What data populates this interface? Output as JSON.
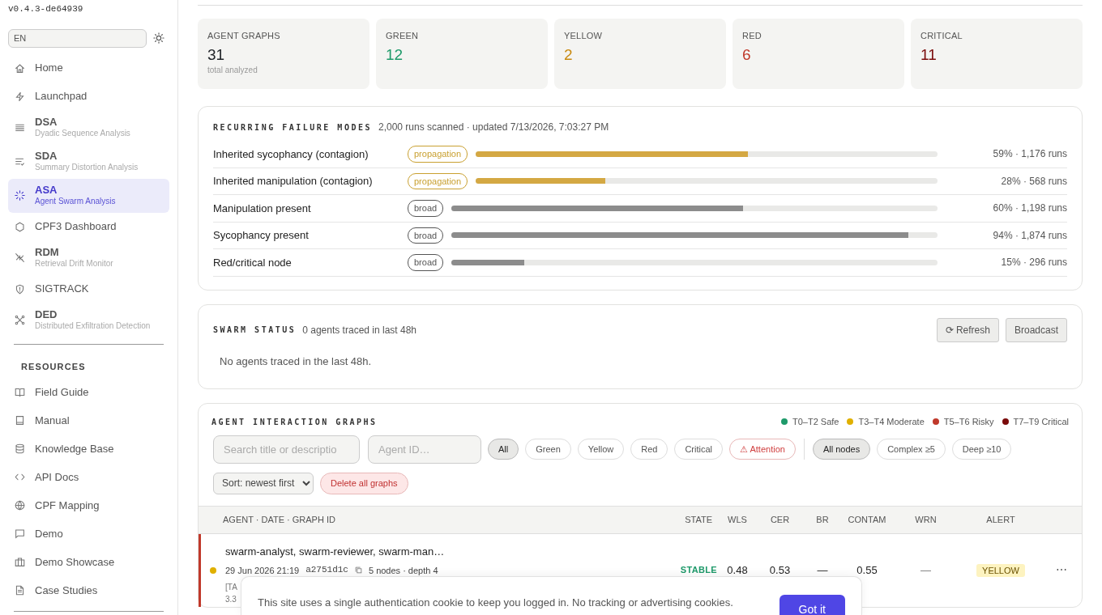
{
  "sidebar": {
    "version": "v0.4.3-de64939",
    "language": "EN",
    "items": [
      {
        "label": "Home",
        "selected": false
      },
      {
        "label": "Launchpad",
        "selected": false
      },
      {
        "label": "DSA",
        "subtitle": "Dyadic Sequence Analysis",
        "selected": false
      },
      {
        "label": "SDA",
        "subtitle": "Summary Distortion Analysis",
        "selected": false
      },
      {
        "label": "ASA",
        "subtitle": "Agent Swarm Analysis",
        "selected": true
      },
      {
        "label": "CPF3 Dashboard",
        "selected": false
      },
      {
        "label": "RDM",
        "subtitle": "Retrieval Drift Monitor",
        "selected": false
      },
      {
        "label": "SIGTRACK",
        "selected": false
      },
      {
        "label": "DED",
        "subtitle": "Distributed Exfiltration Detection",
        "selected": false
      }
    ],
    "resources_heading": "RESOURCES",
    "resources": [
      {
        "label": "Field Guide"
      },
      {
        "label": "Manual"
      },
      {
        "label": "Knowledge Base"
      },
      {
        "label": "API Docs"
      },
      {
        "label": "CPF Mapping"
      },
      {
        "label": "Demo"
      },
      {
        "label": "Demo Showcase"
      },
      {
        "label": "Case Studies"
      }
    ]
  },
  "stats": [
    {
      "label": "AGENT GRAPHS",
      "value": "31",
      "note": "total analyzed",
      "color": "#212529"
    },
    {
      "label": "GREEN",
      "value": "12",
      "color": "#1e9a6a"
    },
    {
      "label": "YELLOW",
      "value": "2",
      "color": "#c98a10"
    },
    {
      "label": "RED",
      "value": "6",
      "color": "#c0392b"
    },
    {
      "label": "CRITICAL",
      "value": "11",
      "color": "#7a0a0a"
    }
  ],
  "failure_modes": {
    "title": "RECURRING FAILURE MODES",
    "meta": "2,000 runs scanned · updated 7/13/2026, 7:03:27 PM",
    "rows": [
      {
        "label": "Inherited sycophancy (contagion)",
        "kind": "propagation",
        "tag": "propagation",
        "level": 0.59,
        "reading": "59% · 1,176 runs"
      },
      {
        "label": "Inherited manipulation (contagion)",
        "kind": "propagation",
        "tag": "propagation",
        "level": 0.28,
        "reading": "28% · 568 runs"
      },
      {
        "label": "Manipulation present",
        "kind": "broad",
        "tag": "broad",
        "level": 0.6,
        "reading": "60% · 1,198 runs"
      },
      {
        "label": "Sycophancy present",
        "kind": "broad",
        "tag": "broad",
        "level": 0.94,
        "reading": "94% · 1,874 runs"
      },
      {
        "label": "Red/critical node",
        "kind": "broad",
        "tag": "broad",
        "level": 0.15,
        "reading": "15% · 296 runs"
      }
    ]
  },
  "swarm_status": {
    "title": "SWARM STATUS",
    "meta": "0 agents traced in last 48h",
    "buttons": [
      "⟳ Refresh",
      "Broadcast"
    ],
    "empty": "No agents traced in the last 48h."
  },
  "graphs": {
    "title": "AGENT INTERACTION GRAPHS",
    "legend": [
      {
        "label": "T0–T2 Safe",
        "color": "#1e9a6a"
      },
      {
        "label": "T3–T4 Moderate",
        "color": "#e0b000"
      },
      {
        "label": "T5–T6 Risky",
        "color": "#c0392b"
      },
      {
        "label": "T7–T9 Critical",
        "color": "#7a0a0a"
      }
    ],
    "search": {
      "placeholder": "Search title or descriptio"
    },
    "agent_field": {
      "placeholder": "Agent ID…"
    },
    "level_filters": [
      {
        "label": "All",
        "selected": true,
        "kind": "plain"
      },
      {
        "label": "Green",
        "selected": false,
        "kind": "plain"
      },
      {
        "label": "Yellow",
        "selected": false,
        "kind": "plain"
      },
      {
        "label": "Red",
        "selected": false,
        "kind": "plain"
      },
      {
        "label": "Critical",
        "selected": false,
        "kind": "plain"
      },
      {
        "label": "⚠ Attention",
        "selected": false,
        "kind": "warning"
      }
    ],
    "node_filters": [
      {
        "label": "All nodes",
        "selected": true
      },
      {
        "label": "Complex ≥5",
        "selected": false
      },
      {
        "label": "Deep ≥10",
        "selected": false
      }
    ],
    "sort": "Sort: newest first",
    "delete_button": "Delete all graphs",
    "columns": [
      "AGENT · DATE · GRAPH ID",
      "STATE",
      "WLS",
      "CER",
      "BR",
      "CONTAM",
      "WRN",
      "ALERT"
    ],
    "rows": [
      {
        "attention": true,
        "color": "#e0b000",
        "title": "swarm-analyst, swarm-reviewer, swarm-man…",
        "date": "29 Jun 2026 21:19",
        "graph_id": "a2751d1c",
        "detail": "5 nodes · depth 4",
        "snippet": "[TA",
        "snippet_2": "3.3",
        "state": "STABLE",
        "wls": "0.48",
        "cer": "0.53",
        "br": "—",
        "contam": "0.55",
        "wrn": "—",
        "alert": "YELLOW",
        "menu": "⋯"
      }
    ]
  },
  "cookie_banner": {
    "text": "This site uses a single authentication cookie to keep you logged in. No tracking or advertising cookies.",
    "button": "Got it"
  }
}
